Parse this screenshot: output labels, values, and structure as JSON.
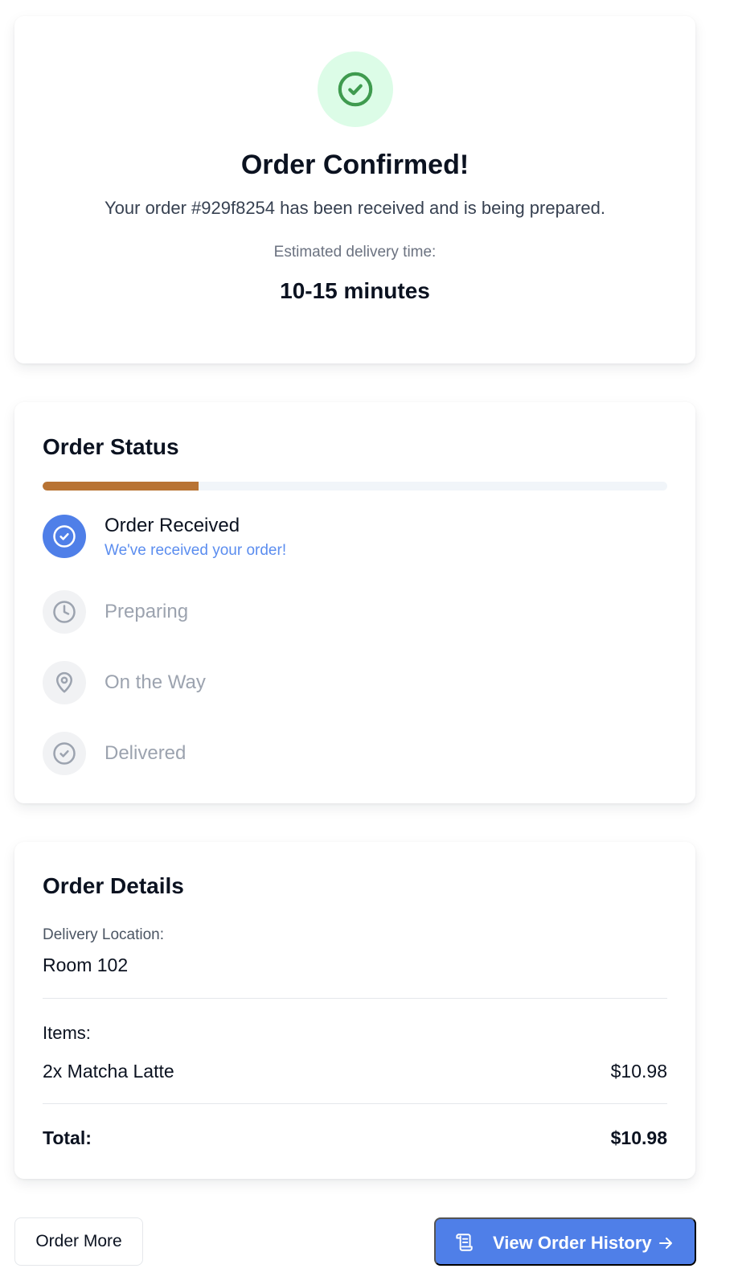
{
  "confirmation": {
    "title": "Order Confirmed!",
    "message": "Your order #929f8254 has been received and is being prepared.",
    "eta_label": "Estimated delivery time:",
    "eta_value": "10-15 minutes",
    "icon": "check-circle-icon",
    "accent_color": "#3f9b4f"
  },
  "status": {
    "title": "Order Status",
    "progress_fraction": 0.25,
    "progress_color": "#b87333",
    "steps": [
      {
        "label": "Order Received",
        "subtitle": "We've received your order!",
        "icon": "check-circle-icon",
        "state": "active"
      },
      {
        "label": "Preparing",
        "icon": "clock-icon",
        "state": "inactive"
      },
      {
        "label": "On the Way",
        "icon": "map-pin-icon",
        "state": "inactive"
      },
      {
        "label": "Delivered",
        "icon": "check-circle-icon",
        "state": "inactive"
      }
    ]
  },
  "details": {
    "title": "Order Details",
    "location_label": "Delivery Location:",
    "location_value": "Room 102",
    "items_label": "Items:",
    "items": [
      {
        "name": "2x Matcha Latte",
        "price": "$10.98"
      }
    ],
    "total_label": "Total:",
    "total_value": "$10.98"
  },
  "actions": {
    "order_more": "Order More",
    "view_history": "View Order History",
    "primary_color": "#4f7fe8"
  }
}
